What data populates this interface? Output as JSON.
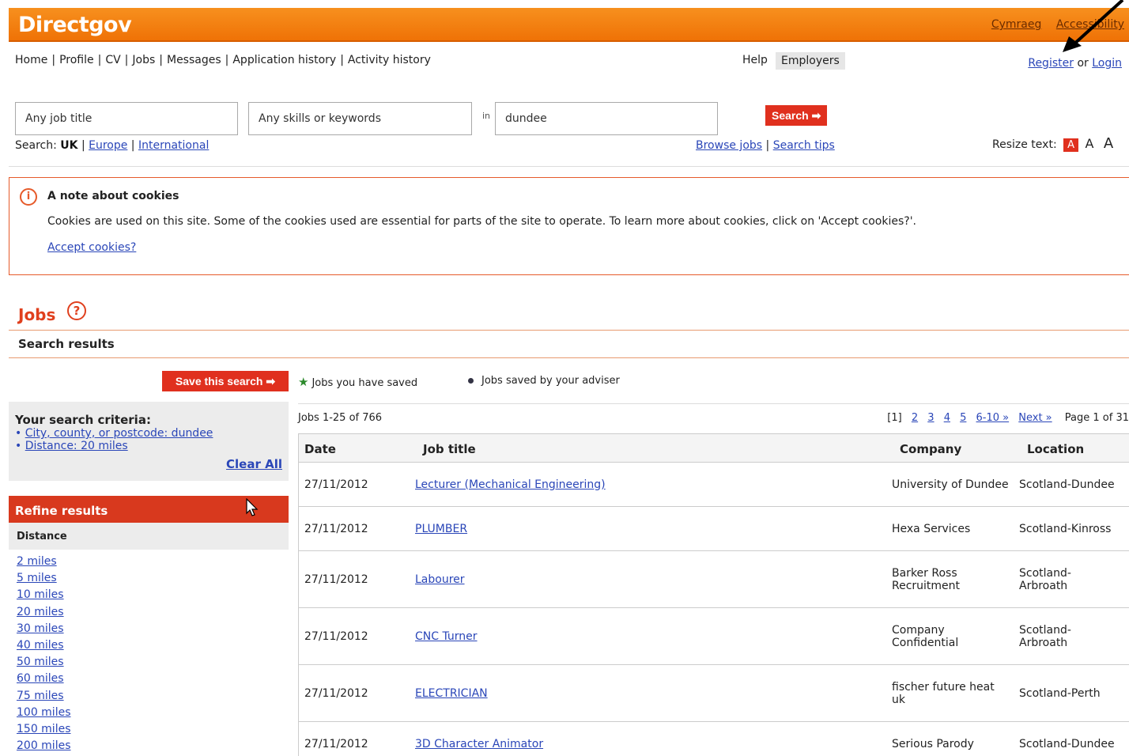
{
  "header": {
    "logo": "Directgov",
    "links": [
      "Cymraeg",
      "Accessibility"
    ]
  },
  "nav": {
    "items": [
      "Home",
      "Profile",
      "CV",
      "Jobs",
      "Messages",
      "Application history",
      "Activity history"
    ],
    "help": "Help",
    "employers": "Employers",
    "register": "Register",
    "or": "or",
    "login": "Login"
  },
  "search": {
    "job_title_value": "Any job title",
    "skills_value": "Any skills or keywords",
    "in_label": "in",
    "location_value": "dundee",
    "button": "Search",
    "scope_label": "Search:",
    "scope_uk": "UK",
    "scope_europe": "Europe",
    "scope_international": "International",
    "browse_jobs": "Browse jobs",
    "search_tips": "Search tips",
    "resize_label": "Resize text:",
    "resize_small": "A",
    "resize_medium": "A",
    "resize_large": "A"
  },
  "cookies": {
    "title": "A note about cookies",
    "message": "Cookies are used on this site. Some of the cookies used are essential for parts of the site to operate. To learn more about cookies, click on 'Accept cookies?'.",
    "accept": "Accept cookies?"
  },
  "jobs": {
    "heading": "Jobs",
    "results_heading": "Search results",
    "save_search": "Save this search",
    "legend_saved": "Jobs you have saved",
    "legend_adviser": "Jobs saved by your adviser"
  },
  "criteria": {
    "title": "Your search criteria:",
    "items": [
      "City, county, or postcode: dundee",
      "Distance: 20 miles"
    ],
    "clear_all": "Clear All"
  },
  "refine": {
    "title": "Refine results",
    "distance_heading": "Distance",
    "distances": [
      "2 miles",
      "5 miles",
      "10 miles",
      "20 miles",
      "30 miles",
      "40 miles",
      "50 miles",
      "60 miles",
      "75 miles",
      "100 miles",
      "150 miles",
      "200 miles"
    ]
  },
  "results": {
    "count": "Jobs 1-25 of 766",
    "pager_current": "[1]",
    "pager_pages": [
      "2",
      "3",
      "4",
      "5",
      "6-10 »",
      "Next »"
    ],
    "page_of": "Page 1 of 31",
    "columns": [
      "Date",
      "Job title",
      "Company",
      "Location"
    ],
    "rows": [
      {
        "date": "27/11/2012",
        "title": "Lecturer (Mechanical Engineering)",
        "company": "University of Dundee",
        "location": "Scotland-Dundee"
      },
      {
        "date": "27/11/2012",
        "title": "PLUMBER",
        "company": "Hexa Services",
        "location": "Scotland-Kinross"
      },
      {
        "date": "27/11/2012",
        "title": "Labourer",
        "company": "Barker Ross Recruitment",
        "location": "Scotland-Arbroath"
      },
      {
        "date": "27/11/2012",
        "title": "CNC Turner",
        "company": "Company Confidential",
        "location": "Scotland-Arbroath"
      },
      {
        "date": "27/11/2012",
        "title": "ELECTRICIAN",
        "company": "fischer future heat uk",
        "location": "Scotland-Perth"
      },
      {
        "date": "27/11/2012",
        "title": "3D Character Animator",
        "company": "Serious Parody",
        "location": "Scotland-Dundee"
      }
    ]
  },
  "colors": {
    "brand_orange": "#f7901e",
    "accent_red": "#e0301e",
    "link_blue": "#2a46b8"
  }
}
